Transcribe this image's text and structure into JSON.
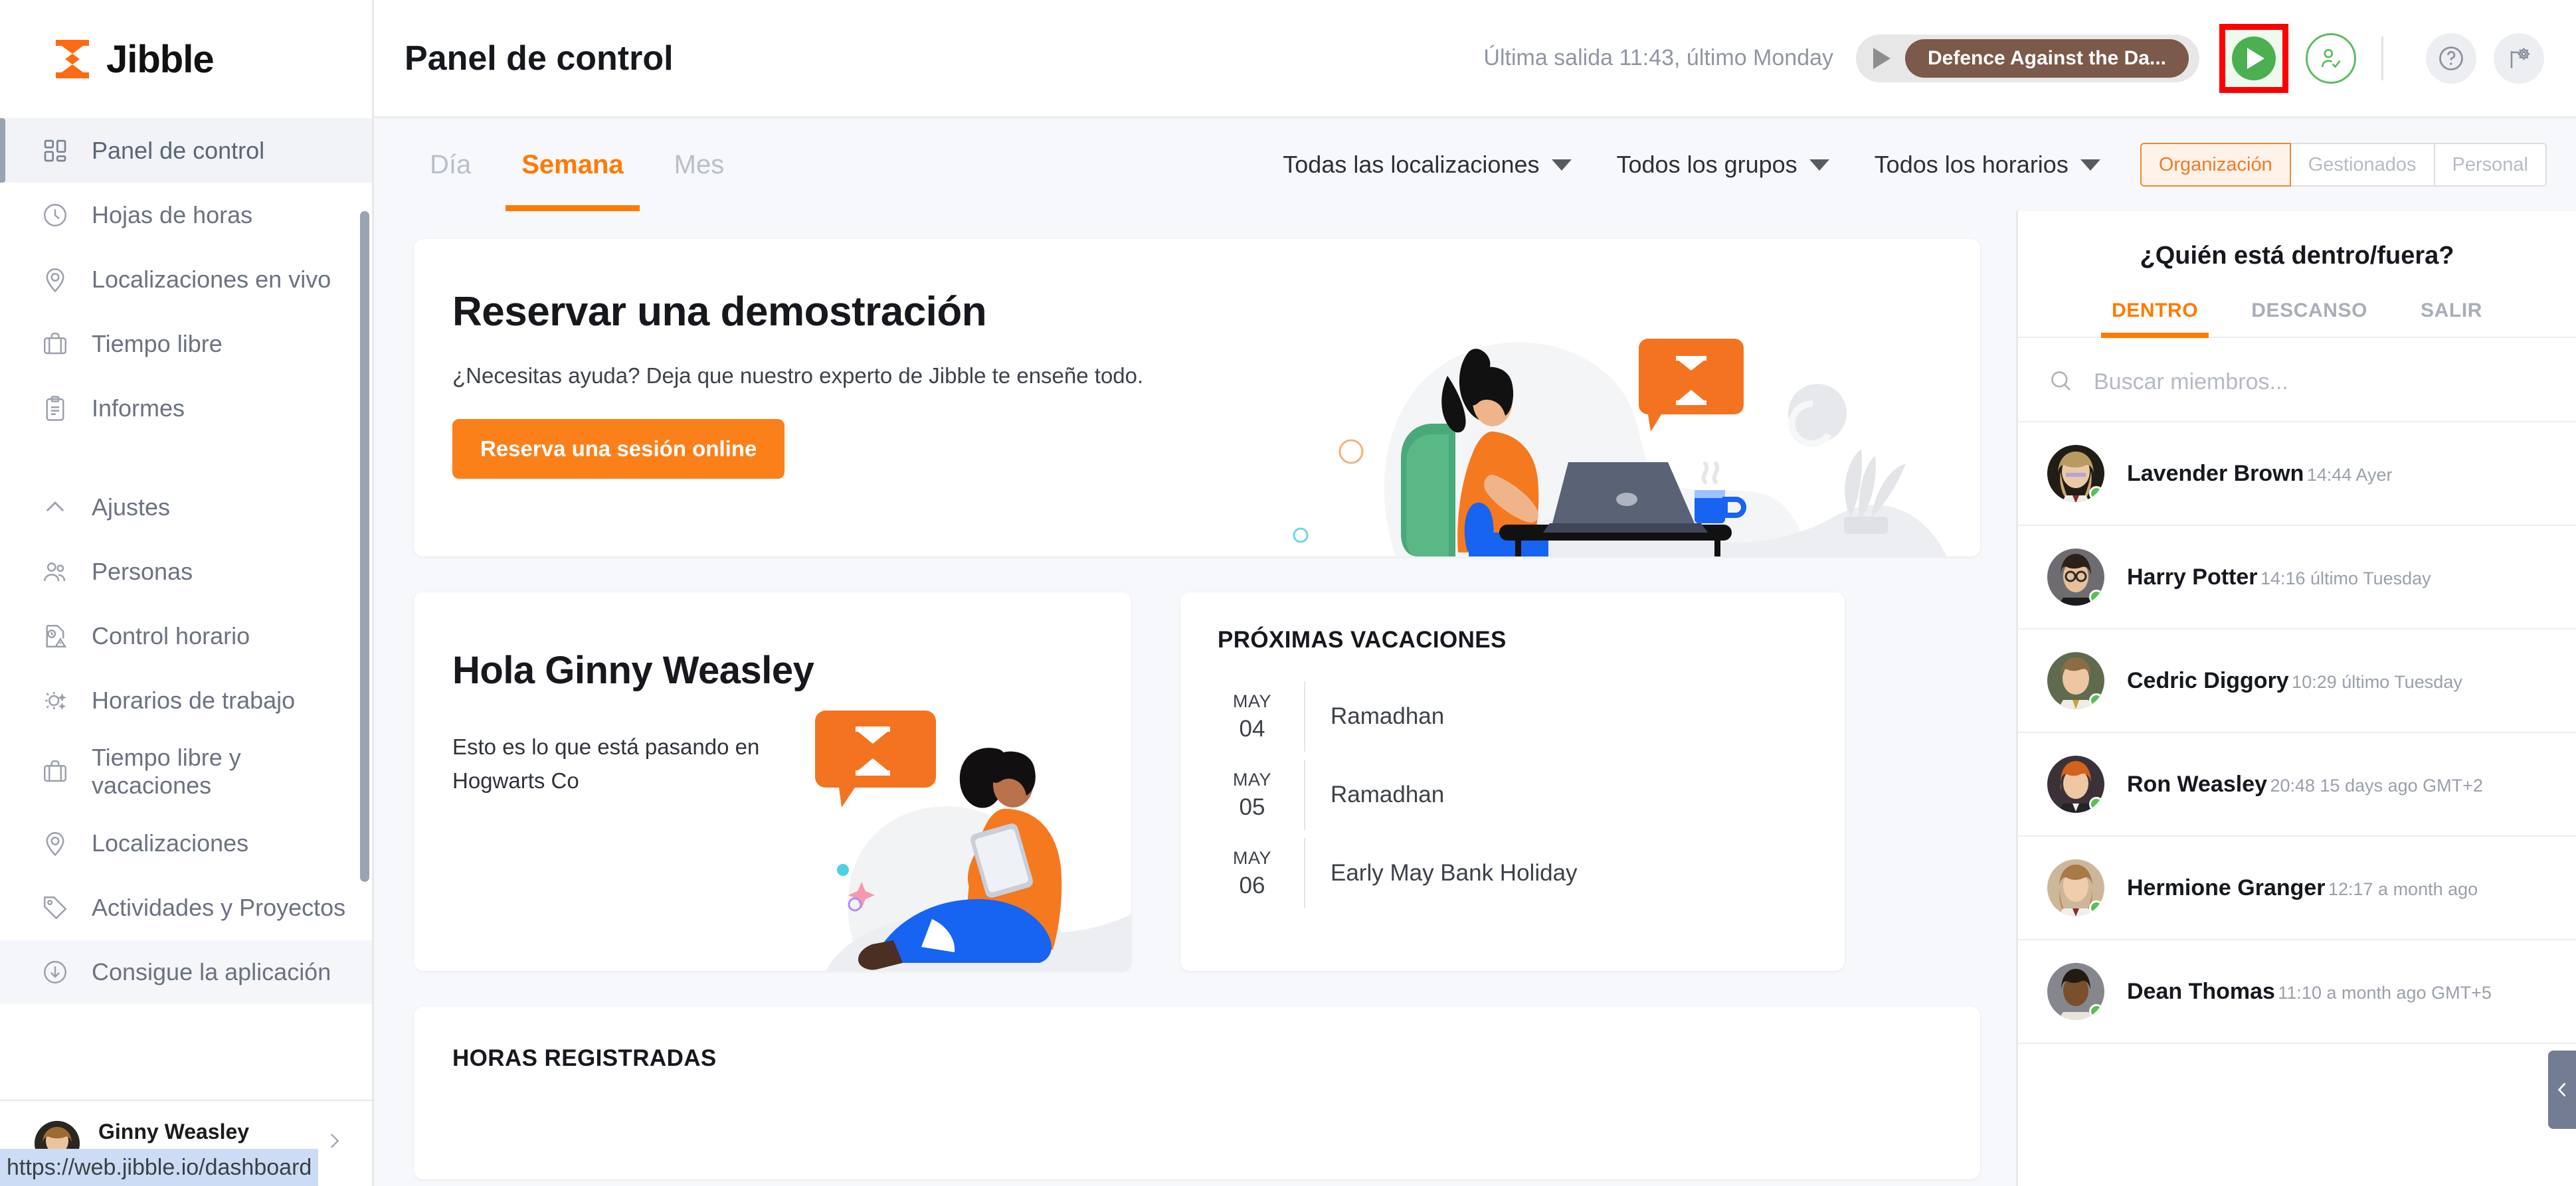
{
  "brand": {
    "name": "Jibble",
    "logo_icon": "hourglass-logo-icon",
    "accent": "#ff7a00"
  },
  "sidebar": {
    "items": [
      {
        "label": "Panel de control",
        "icon": "dashboard-grid-icon",
        "active": true
      },
      {
        "label": "Hojas de horas",
        "icon": "clock-icon",
        "active": false
      },
      {
        "label": "Localizaciones en vivo",
        "icon": "map-pin-icon",
        "active": false
      },
      {
        "label": "Tiempo libre",
        "icon": "briefcase-icon",
        "active": false
      },
      {
        "label": "Informes",
        "icon": "clipboard-icon",
        "active": false
      }
    ],
    "settings_group": {
      "label": "Ajustes",
      "icon": "chevron-up-icon",
      "items": [
        {
          "label": "Personas",
          "icon": "people-icon"
        },
        {
          "label": "Control horario",
          "icon": "time-policy-icon"
        },
        {
          "label": "Horarios de trabajo",
          "icon": "sun-schedule-icon"
        },
        {
          "label": "Tiempo libre y vacaciones",
          "icon": "briefcase-icon"
        },
        {
          "label": "Localizaciones",
          "icon": "map-pin-icon"
        },
        {
          "label": "Actividades y Proyectos",
          "icon": "tag-icon"
        }
      ]
    },
    "get_app": {
      "label": "Consigue la aplicación",
      "icon": "download-circle-icon"
    },
    "profile": {
      "name": "Ginny Weasley",
      "org": "Hogwarts Co",
      "chevron_icon": "chevron-right-icon",
      "avatar": "ginny-avatar"
    },
    "status_url": "https://web.jibble.io/dashboard"
  },
  "header": {
    "title": "Panel de control",
    "last_out": "Última salida 11:43, último Monday",
    "activity": {
      "play_icon": "play-triangle-icon",
      "chip_label": "Defence Against the Da...",
      "chip_color": "#7b5a4b"
    },
    "start_button": {
      "icon": "play-button-icon",
      "color": "#4caf50",
      "highlight_color": "#ff0000"
    },
    "add_user_button": {
      "icon": "user-check-icon"
    },
    "help_button": {
      "icon": "question-circle-icon"
    },
    "settings_button": {
      "icon": "gear-flag-icon"
    }
  },
  "subheader": {
    "period_tabs": [
      {
        "label": "Día",
        "active": false
      },
      {
        "label": "Semana",
        "active": true
      },
      {
        "label": "Mes",
        "active": false
      }
    ],
    "filters": [
      {
        "label": "Todas las localizaciones",
        "icon": "chevron-down-icon"
      },
      {
        "label": "Todos los grupos",
        "icon": "chevron-down-icon"
      },
      {
        "label": "Todos los horarios",
        "icon": "chevron-down-icon"
      }
    ],
    "scope": [
      {
        "label": "Organización",
        "active": true
      },
      {
        "label": "Gestionados",
        "active": false
      },
      {
        "label": "Personal",
        "active": false
      }
    ]
  },
  "main": {
    "demo": {
      "title": "Reservar una demostración",
      "subtitle": "¿Necesitas ayuda? Deja que nuestro experto de Jibble te enseñe todo.",
      "button": "Reserva una sesión online"
    },
    "hello": {
      "title": "Hola Ginny Weasley",
      "subtitle": "Esto es lo que está pasando en Hogwarts Co"
    },
    "vacations": {
      "title": "PRÓXIMAS VACACIONES",
      "items": [
        {
          "month": "MAY",
          "day": "04",
          "name": "Ramadhan"
        },
        {
          "month": "MAY",
          "day": "05",
          "name": "Ramadhan"
        },
        {
          "month": "MAY",
          "day": "06",
          "name": "Early May Bank Holiday"
        }
      ]
    },
    "hours": {
      "title": "HORAS REGISTRADAS"
    }
  },
  "right_panel": {
    "title": "¿Quién está dentro/fuera?",
    "tabs": [
      {
        "label": "DENTRO",
        "active": true
      },
      {
        "label": "DESCANSO",
        "active": false
      },
      {
        "label": "SALIR",
        "active": false
      }
    ],
    "search": {
      "placeholder": "Buscar miembros...",
      "icon": "search-icon"
    },
    "members": [
      {
        "name": "Lavender Brown",
        "time": "14:44 Ayer",
        "status_color": "#55c157",
        "avatar_tone": "#c9b79a"
      },
      {
        "name": "Harry Potter",
        "time": "14:16 último Tuesday",
        "status_color": "#55c157",
        "avatar_tone": "#6b6a6e"
      },
      {
        "name": "Cedric Diggory",
        "time": "10:29 último Tuesday",
        "status_color": "#55c157",
        "avatar_tone": "#8b7f66"
      },
      {
        "name": "Ron Weasley",
        "time": "20:48 15 days ago GMT+2",
        "status_color": "#55c157",
        "avatar_tone": "#4a4047"
      },
      {
        "name": "Hermione Granger",
        "time": "12:17 a month ago",
        "status_color": "#55c157",
        "avatar_tone": "#b9a585"
      },
      {
        "name": "Dean Thomas",
        "time": "11:10 a month ago GMT+5",
        "status_color": "#55c157",
        "avatar_tone": "#7a7a80"
      }
    ],
    "collapse_button": {
      "icon": "chevron-left-icon"
    }
  }
}
